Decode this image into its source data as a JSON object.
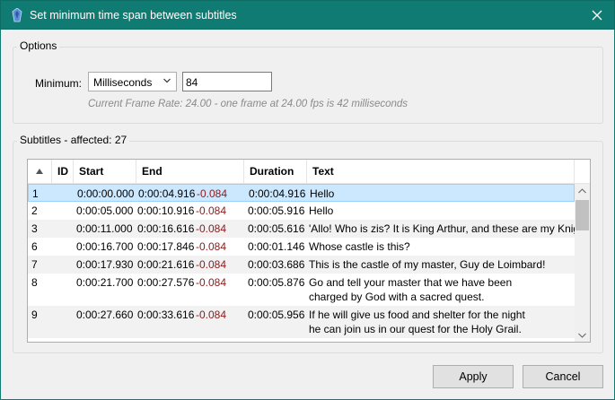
{
  "window": {
    "title": "Set minimum time span between subtitles",
    "close_icon": "close-icon",
    "app_icon": "subtitle-edit-icon"
  },
  "options": {
    "group_title": "Options",
    "minimum_label": "Minimum:",
    "unit_selected": "Milliseconds",
    "minimum_value": "84",
    "frame_rate_note": "Current Frame Rate: 24.00 - one frame at 24.00 fps is 42 milliseconds"
  },
  "subtitles": {
    "group_title": "Subtitles - affected: 27",
    "columns": [
      "ID",
      "Start",
      "End",
      "Duration",
      "Text"
    ],
    "rows": [
      {
        "id": "1",
        "start": "0:00:00.000",
        "end": "0:00:04.916",
        "change": "-0.084",
        "duration": "0:00:04.916",
        "text1": "Hello",
        "text2": ""
      },
      {
        "id": "2",
        "start": "0:00:05.000",
        "end": "0:00:10.916",
        "change": "-0.084",
        "duration": "0:00:05.916",
        "text1": "Hello",
        "text2": ""
      },
      {
        "id": "3",
        "start": "0:00:11.000",
        "end": "0:00:16.616",
        "change": "-0.084",
        "duration": "0:00:05.616",
        "text1": "'Allo! Who is zis? It is King Arthur, and these are my Knig",
        "text2": ""
      },
      {
        "id": "6",
        "start": "0:00:16.700",
        "end": "0:00:17.846",
        "change": "-0.084",
        "duration": "0:00:01.146",
        "text1": "Whose castle is this?",
        "text2": ""
      },
      {
        "id": "7",
        "start": "0:00:17.930",
        "end": "0:00:21.616",
        "change": "-0.084",
        "duration": "0:00:03.686",
        "text1": "This is the castle of my master, Guy de Loimbard!",
        "text2": ""
      },
      {
        "id": "8",
        "start": "0:00:21.700",
        "end": "0:00:27.576",
        "change": "-0.084",
        "duration": "0:00:05.876",
        "text1": "Go and tell your master that we have been",
        "text2": "charged by God with a sacred quest."
      },
      {
        "id": "9",
        "start": "0:00:27.660",
        "end": "0:00:33.616",
        "change": "-0.084",
        "duration": "0:00:05.956",
        "text1": "If he will give us food and shelter for the night",
        "text2": "he can join us in our quest for the Holy Grail."
      }
    ]
  },
  "buttons": {
    "apply": "Apply",
    "cancel": "Cancel"
  },
  "colors": {
    "titlebar": "#0f7b72",
    "selection": "#cce8ff",
    "change_text": "#8b1a1a",
    "note_text": "#8a8a8a"
  }
}
